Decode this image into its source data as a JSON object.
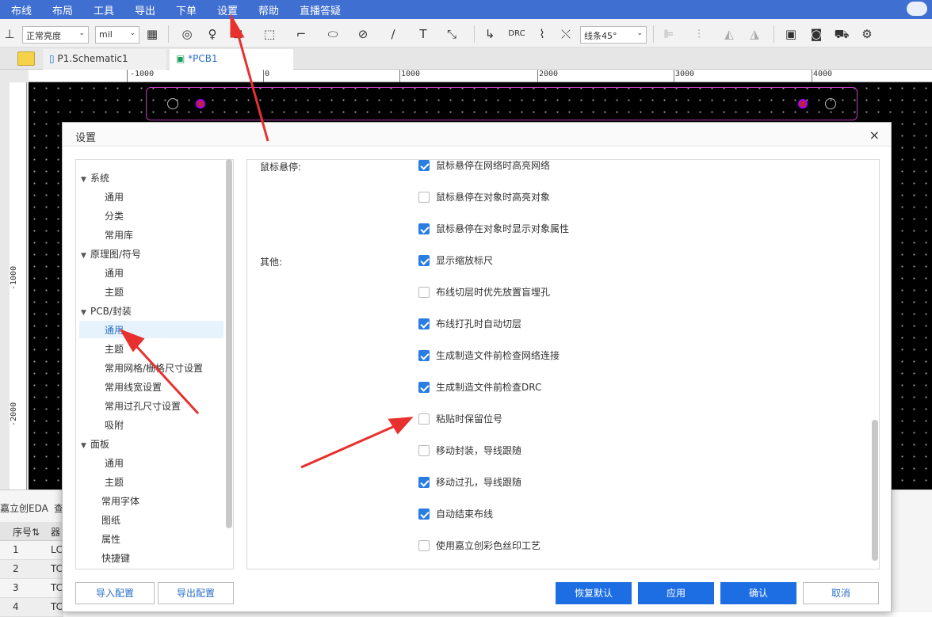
{
  "menu": [
    "布线",
    "布局",
    "工具",
    "导出",
    "下单",
    "设置",
    "帮助",
    "直播答疑"
  ],
  "toolbar": {
    "brightness": "正常亮度",
    "unit": "mil",
    "wire_mode": "线条45°"
  },
  "tabs": {
    "schematic": "P1.Schematic1",
    "pcb": "*PCB1"
  },
  "ruler": {
    "h": [
      "-1000",
      "0",
      "1000",
      "2000",
      "3000",
      "4000"
    ],
    "v": [
      "-1000",
      "-2000"
    ]
  },
  "bottom": {
    "tab": "嘉立创EDA",
    "tab2": "查",
    "col1": "序号⇅",
    "col2": "器",
    "rows": [
      [
        "1",
        "LC"
      ],
      [
        "2",
        "TC"
      ],
      [
        "3",
        "TC"
      ],
      [
        "4",
        "TC"
      ]
    ]
  },
  "dialog": {
    "title": "设置",
    "close": "×",
    "tree": [
      {
        "label": "系统",
        "level": 0,
        "expanded": true
      },
      {
        "label": "通用",
        "level": 1
      },
      {
        "label": "分类",
        "level": 1
      },
      {
        "label": "常用库",
        "level": 1
      },
      {
        "label": "原理图/符号",
        "level": 0,
        "expanded": true
      },
      {
        "label": "通用",
        "level": 1
      },
      {
        "label": "主题",
        "level": 1
      },
      {
        "label": "PCB/封装",
        "level": 0,
        "expanded": true
      },
      {
        "label": "通用",
        "level": 1,
        "selected": true
      },
      {
        "label": "主题",
        "level": 1
      },
      {
        "label": "常用网格/栅格尺寸设置",
        "level": 1
      },
      {
        "label": "常用线宽设置",
        "level": 1
      },
      {
        "label": "常用过孔尺寸设置",
        "level": 1
      },
      {
        "label": "吸附",
        "level": 1
      },
      {
        "label": "面板",
        "level": 0,
        "expanded": true
      },
      {
        "label": "通用",
        "level": 1
      },
      {
        "label": "主题",
        "level": 1
      },
      {
        "label": "常用字体",
        "level": 0,
        "leaf": true
      },
      {
        "label": "图纸",
        "level": 0,
        "leaf": true
      },
      {
        "label": "属性",
        "level": 0,
        "leaf": true
      },
      {
        "label": "快捷键",
        "level": 0,
        "leaf": true
      }
    ],
    "sections": {
      "hover": "鼠标悬停:",
      "other": "其他:"
    },
    "options": [
      {
        "label": "鼠标悬停在网络时高亮网络",
        "checked": true
      },
      {
        "label": "鼠标悬停在对象时高亮对象",
        "checked": false
      },
      {
        "label": "鼠标悬停在对象时显示对象属性",
        "checked": true
      },
      {
        "label": "显示缩放标尺",
        "checked": true
      },
      {
        "label": "布线切层时优先放置盲埋孔",
        "checked": false
      },
      {
        "label": "布线打孔时自动切层",
        "checked": true
      },
      {
        "label": "生成制造文件前检查网络连接",
        "checked": true
      },
      {
        "label": "生成制造文件前检查DRC",
        "checked": true
      },
      {
        "label": "粘贴时保留位号",
        "checked": false
      },
      {
        "label": "移动封装，导线跟随",
        "checked": false
      },
      {
        "label": "移动过孔，导线跟随",
        "checked": true
      },
      {
        "label": "自动结束布线",
        "checked": true
      },
      {
        "label": "使用嘉立创彩色丝印工艺",
        "checked": false
      }
    ],
    "buttons": {
      "import": "导入配置",
      "export": "导出配置",
      "restore": "恢复默认",
      "apply": "应用",
      "ok": "确认",
      "cancel": "取消"
    }
  },
  "colors": {
    "accent": "#1e6ee3",
    "menubar": "#3f6fd0",
    "arrow": "#e8312f"
  }
}
